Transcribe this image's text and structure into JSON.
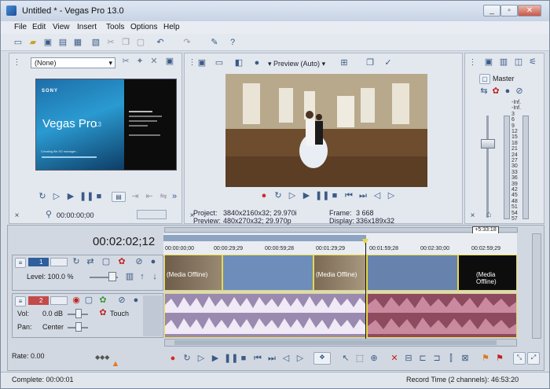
{
  "window": {
    "title": "Untitled * - Vegas Pro 13.0"
  },
  "menu": [
    "File",
    "Edit",
    "View",
    "Insert",
    "Tools",
    "Options",
    "Help"
  ],
  "explorer": {
    "dropdown_value": "(None)"
  },
  "splash": {
    "brand": "SONY",
    "product": "Vegas Pro",
    "version": "13",
    "status": "Creating file I/O manager..."
  },
  "trimmer": {
    "timecode": "00:00:00;00"
  },
  "preview": {
    "mode": "Preview (Auto)",
    "project_label": "Project:",
    "project_value": "3840x2160x32; 29.970i",
    "preview_label": "Preview:",
    "preview_value": "480x270x32; 29.970p",
    "frame_label": "Frame:",
    "frame_value": "3 668",
    "display_label": "Display:",
    "display_value": "336x189x32"
  },
  "mixer": {
    "master_label": "Master",
    "db_labels": [
      "-Inf.",
      "-Inf.",
      "3",
      "6",
      "9",
      "12",
      "15",
      "18",
      "21",
      "24",
      "27",
      "30",
      "33",
      "36",
      "39",
      "42",
      "45",
      "48",
      "51",
      "54",
      "57"
    ]
  },
  "timeline": {
    "current_time": "00:02:02;12",
    "marker_time": "+5:33:18",
    "ruler_labels": [
      "00:00:00;00",
      "00:00:29;29",
      "00:00:59;28",
      "00:01:29;29",
      "00:01:59;28",
      "00:02:30;00",
      "00:02:59;29"
    ],
    "video_track": {
      "number": "1",
      "level_label": "Level: 100.0 %"
    },
    "audio_track": {
      "number": "2",
      "vol_label": "Vol:",
      "vol_value": "0.0 dB",
      "pan_label": "Pan:",
      "pan_value": "Center",
      "touch": "Touch"
    },
    "offline_labels": [
      "(Media Offline)",
      "(Media Offline)",
      "(Media Offline)"
    ],
    "rate": "Rate: 0.00"
  },
  "status": {
    "complete": "Complete: 00:00:01",
    "record_time": "Record Time (2 channels): 46:53:20"
  },
  "colors": {
    "accent": "#2f5f9c",
    "video_track": "#5b7aa8",
    "audio_track": "#7f7295",
    "record": "#d42a2a"
  }
}
